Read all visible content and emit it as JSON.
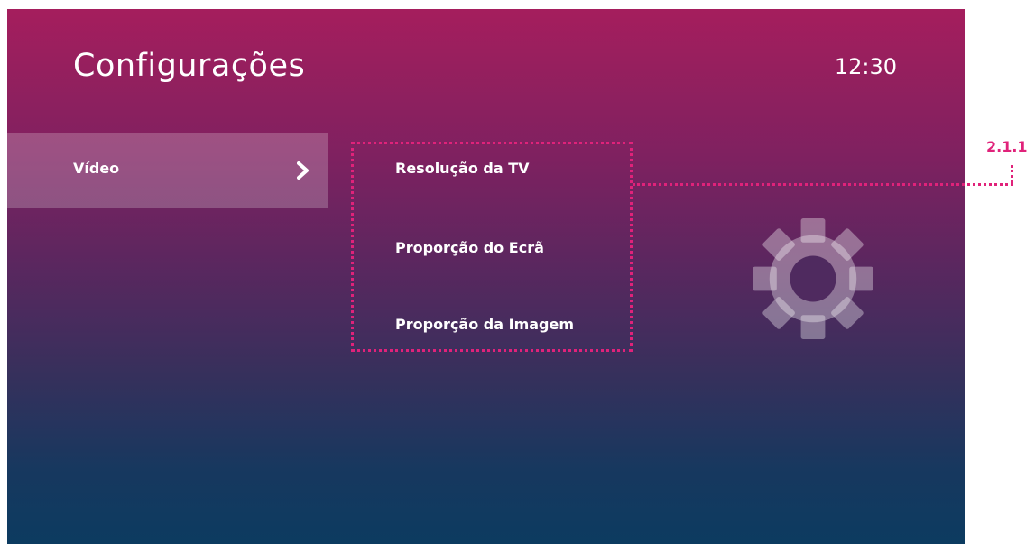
{
  "header": {
    "title": "Configurações",
    "clock": "12:30"
  },
  "sidebar": {
    "items": [
      {
        "label": "Vídeo",
        "selected": true,
        "icon": "chevron-right-icon"
      }
    ]
  },
  "submenu": {
    "items": [
      {
        "label": "Resolução da TV"
      },
      {
        "label": "Proporção do Ecrã"
      },
      {
        "label": "Proporção da Imagem"
      }
    ]
  },
  "decoration": {
    "icon": "gear-icon"
  },
  "annotation": {
    "label": "2.1.1",
    "color": "#e0227a"
  },
  "colors": {
    "gradient_top": "#a51e5d",
    "gradient_bottom": "#0c3b60",
    "highlight": "#e0227a"
  }
}
